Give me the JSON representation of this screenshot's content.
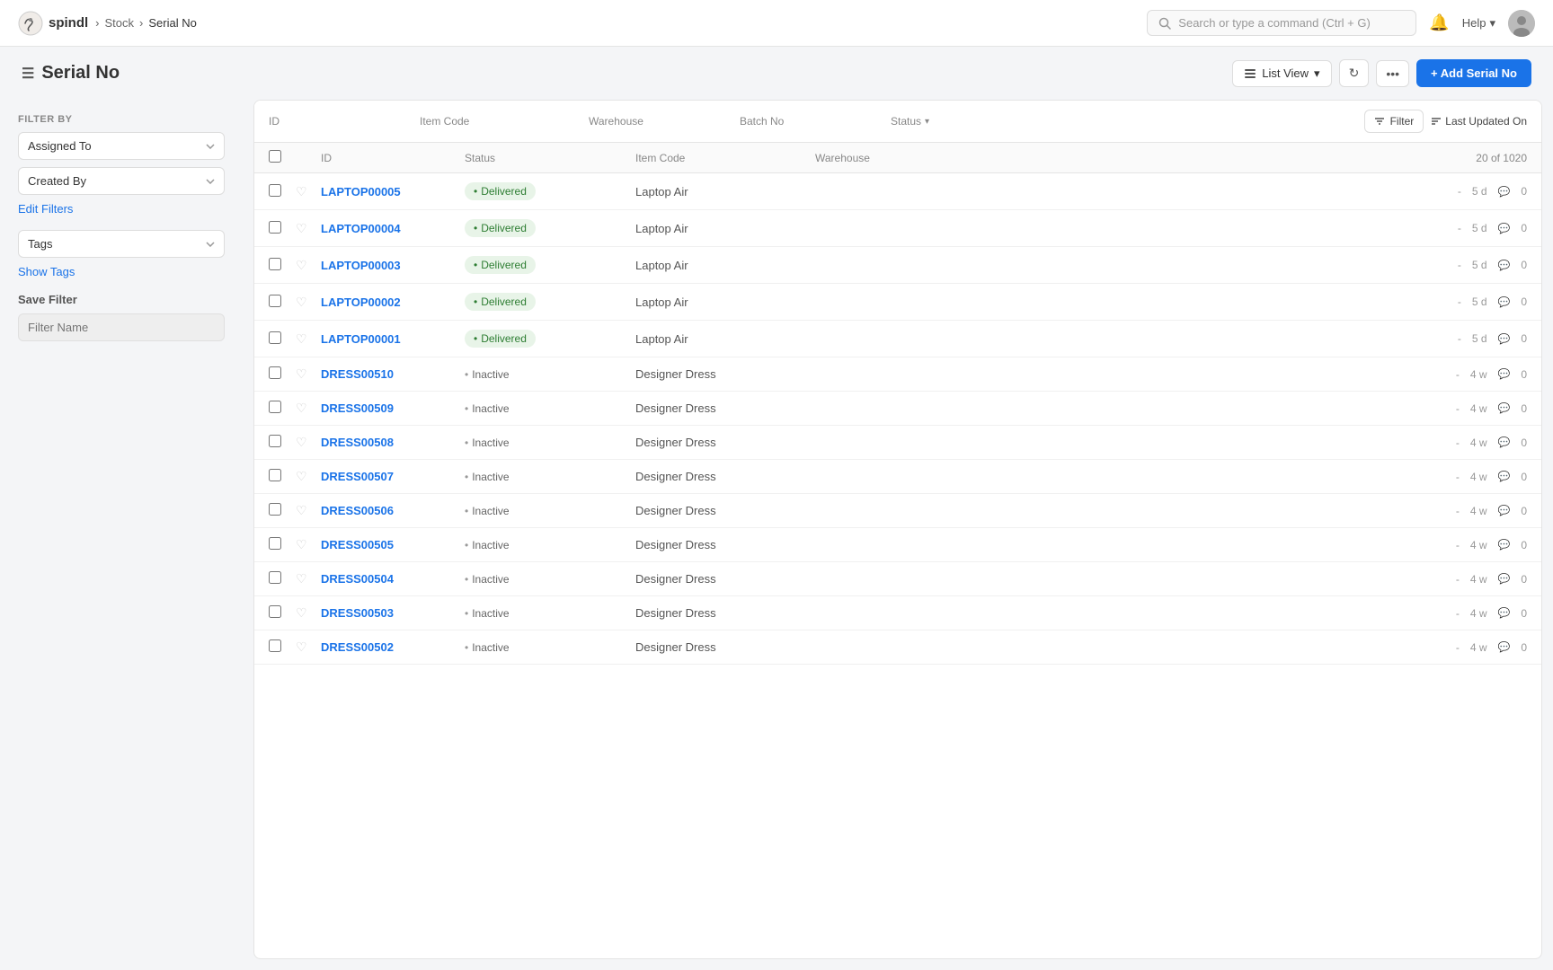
{
  "logo": {
    "text": "spindl"
  },
  "breadcrumbs": [
    "Stock",
    "Serial No"
  ],
  "search": {
    "placeholder": "Search or type a command (Ctrl + G)"
  },
  "help": {
    "label": "Help"
  },
  "page": {
    "title": "Serial No",
    "list_view_label": "List View",
    "add_button_label": "+ Add Serial No"
  },
  "sidebar": {
    "filter_by_label": "Filter By",
    "assigned_to_label": "Assigned To",
    "created_by_label": "Created By",
    "edit_filters_label": "Edit Filters",
    "tags_label": "Tags",
    "show_tags_label": "Show Tags",
    "save_filter_label": "Save Filter",
    "filter_name_placeholder": "Filter Name"
  },
  "col_headers": {
    "id": "ID",
    "item_code": "Item Code",
    "warehouse": "Warehouse",
    "batch_no": "Batch No",
    "status": "Status",
    "filter_label": "Filter",
    "last_updated_on": "Last Updated On"
  },
  "table_headers": {
    "id": "ID",
    "status": "Status",
    "item_code": "Item Code",
    "warehouse": "Warehouse",
    "count": "20 of 1020"
  },
  "rows": [
    {
      "id": "LAPTOP00005",
      "status": "Delivered",
      "item_code": "Laptop Air",
      "warehouse": "",
      "age": "5 d",
      "comments": "0"
    },
    {
      "id": "LAPTOP00004",
      "status": "Delivered",
      "item_code": "Laptop Air",
      "warehouse": "",
      "age": "5 d",
      "comments": "0"
    },
    {
      "id": "LAPTOP00003",
      "status": "Delivered",
      "item_code": "Laptop Air",
      "warehouse": "",
      "age": "5 d",
      "comments": "0"
    },
    {
      "id": "LAPTOP00002",
      "status": "Delivered",
      "item_code": "Laptop Air",
      "warehouse": "",
      "age": "5 d",
      "comments": "0"
    },
    {
      "id": "LAPTOP00001",
      "status": "Delivered",
      "item_code": "Laptop Air",
      "warehouse": "",
      "age": "5 d",
      "comments": "0"
    },
    {
      "id": "DRESS00510",
      "status": "Inactive",
      "item_code": "Designer Dress",
      "warehouse": "",
      "age": "4 w",
      "comments": "0"
    },
    {
      "id": "DRESS00509",
      "status": "Inactive",
      "item_code": "Designer Dress",
      "warehouse": "",
      "age": "4 w",
      "comments": "0"
    },
    {
      "id": "DRESS00508",
      "status": "Inactive",
      "item_code": "Designer Dress",
      "warehouse": "",
      "age": "4 w",
      "comments": "0"
    },
    {
      "id": "DRESS00507",
      "status": "Inactive",
      "item_code": "Designer Dress",
      "warehouse": "",
      "age": "4 w",
      "comments": "0"
    },
    {
      "id": "DRESS00506",
      "status": "Inactive",
      "item_code": "Designer Dress",
      "warehouse": "",
      "age": "4 w",
      "comments": "0"
    },
    {
      "id": "DRESS00505",
      "status": "Inactive",
      "item_code": "Designer Dress",
      "warehouse": "",
      "age": "4 w",
      "comments": "0"
    },
    {
      "id": "DRESS00504",
      "status": "Inactive",
      "item_code": "Designer Dress",
      "warehouse": "",
      "age": "4 w",
      "comments": "0"
    },
    {
      "id": "DRESS00503",
      "status": "Inactive",
      "item_code": "Designer Dress",
      "warehouse": "",
      "age": "4 w",
      "comments": "0"
    },
    {
      "id": "DRESS00502",
      "status": "Inactive",
      "item_code": "Designer Dress",
      "warehouse": "",
      "age": "4 w",
      "comments": "0"
    }
  ]
}
